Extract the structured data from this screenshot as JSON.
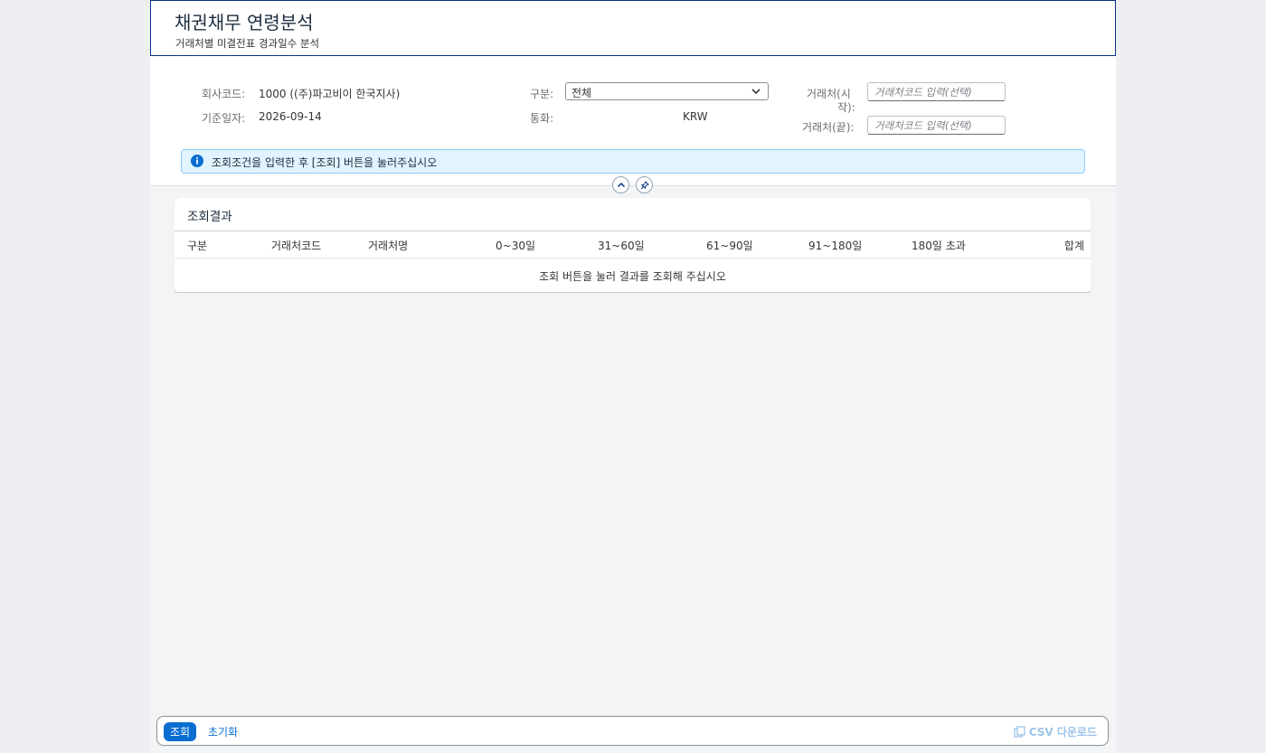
{
  "header": {
    "title": "채권채무 연령분석",
    "subtitle": "거래처별 미결전표 경과일수 분석"
  },
  "filters": {
    "company_label": "회사코드:",
    "company_value": "1000 ((주)파고비이 한국지사)",
    "date_label": "기준일자:",
    "date_value": "2026-09-14",
    "type_label": "구분:",
    "type_value": "전체",
    "currency_label": "통화:",
    "currency_value": "KRW",
    "vendor_from_label_1": "거래처(시",
    "vendor_from_label_2": "작):",
    "vendor_from_placeholder": "거래처코드 입력(선택)",
    "vendor_to_label": "거래처(끝):",
    "vendor_to_placeholder": "거래처코드 입력(선택)"
  },
  "info": {
    "message": "조회조건을 입력한 후 [조회] 버튼을 눌러주십시오"
  },
  "results": {
    "title": "조회결과",
    "columns": [
      "구분",
      "거래처코드",
      "거래처명",
      "0~30일",
      "31~60일",
      "61~90일",
      "91~180일",
      "180일 초과",
      "합계"
    ],
    "empty_message": "조회 버튼을 눌러 결과를 조회해 주십시오"
  },
  "footer": {
    "search_label": "조회",
    "reset_label": "초기화",
    "csv_label": "CSV 다운로드"
  },
  "colors": {
    "primary": "#0a6ed1",
    "header_border": "#0a2f8a",
    "info_bg": "#e1f4ff",
    "info_border": "#91c8f6",
    "disabled_link": "#9cc3ea"
  }
}
